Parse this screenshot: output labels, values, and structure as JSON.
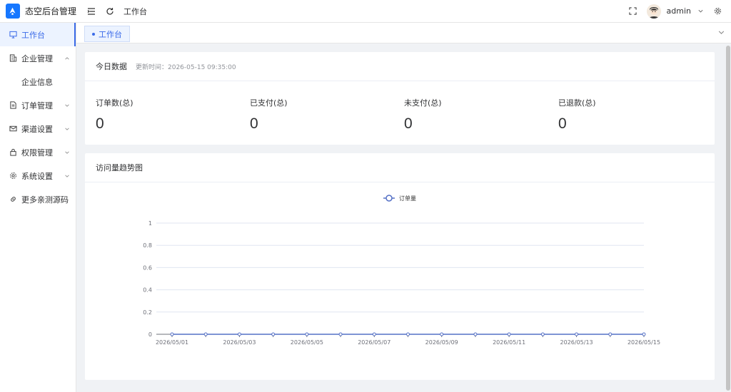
{
  "app": {
    "title": "态空后台管理"
  },
  "header": {
    "breadcrumb": "工作台",
    "username": "admin"
  },
  "sidebar": {
    "items": [
      {
        "label": "工作台",
        "icon": "monitor-icon",
        "active": true
      },
      {
        "label": "企业管理",
        "icon": "building-icon",
        "expanded": true
      },
      {
        "label": "企业信息",
        "sub": true
      },
      {
        "label": "订单管理",
        "icon": "document-icon"
      },
      {
        "label": "渠道设置",
        "icon": "mail-icon"
      },
      {
        "label": "权限管理",
        "icon": "lock-icon"
      },
      {
        "label": "系统设置",
        "icon": "gear-icon"
      },
      {
        "label": "更多亲测源码",
        "icon": "link-icon"
      }
    ]
  },
  "tabs": [
    {
      "label": "工作台"
    }
  ],
  "today": {
    "title": "今日数据",
    "updated": "更新时间：2026-05-15 09:35:00",
    "stats": [
      {
        "label": "订单数(总)",
        "value": "0"
      },
      {
        "label": "已支付(总)",
        "value": "0"
      },
      {
        "label": "未支付(总)",
        "value": "0"
      },
      {
        "label": "已退款(总)",
        "value": "0"
      }
    ]
  },
  "trend": {
    "title": "访问量趋势图"
  },
  "chart_data": {
    "type": "line",
    "x": [
      "2026/05/01",
      "2026/05/02",
      "2026/05/03",
      "2026/05/04",
      "2026/05/05",
      "2026/05/06",
      "2026/05/07",
      "2026/05/08",
      "2026/05/09",
      "2026/05/10",
      "2026/05/11",
      "2026/05/12",
      "2026/05/13",
      "2026/05/14",
      "2026/05/15"
    ],
    "xticks": [
      "2026/05/01",
      "2026/05/03",
      "2026/05/05",
      "2026/05/07",
      "2026/05/09",
      "2026/05/11",
      "2026/05/13",
      "2026/05/15"
    ],
    "series": [
      {
        "name": "订单量",
        "values": [
          0,
          0,
          0,
          0,
          0,
          0,
          0,
          0,
          0,
          0,
          0,
          0,
          0,
          0,
          0
        ],
        "color": "#5470c6"
      }
    ],
    "yticks": [
      "0",
      "0.2",
      "0.4",
      "0.6",
      "0.8",
      "1"
    ],
    "ylim": [
      0,
      1
    ],
    "grid": true,
    "legend": "top-center"
  }
}
